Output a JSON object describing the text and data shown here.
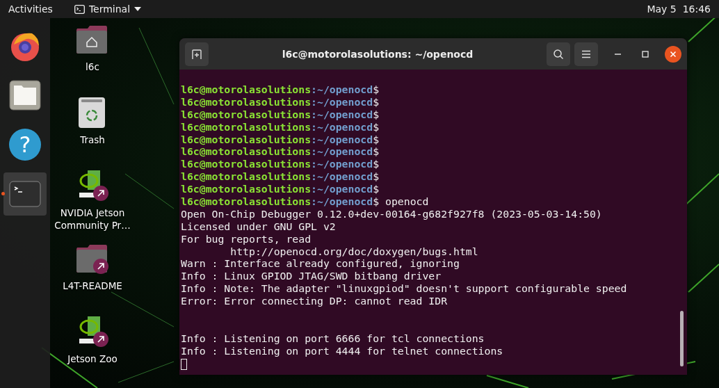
{
  "top_bar": {
    "activities": "Activities",
    "app_menu": "Terminal",
    "clock": "May 5  16:46"
  },
  "dock": [
    {
      "kind": "browser",
      "running": false
    },
    {
      "kind": "files",
      "running": false
    },
    {
      "kind": "help",
      "running": false,
      "glyph": "?"
    },
    {
      "kind": "terminal",
      "running": true
    }
  ],
  "desktop_icons": [
    {
      "kind": "home",
      "label": "l6c",
      "link": false
    },
    {
      "kind": "trash",
      "label": "Trash",
      "link": false
    },
    {
      "kind": "nvidia",
      "label": "NVIDIA Jetson Community Pr…",
      "link": true
    },
    {
      "kind": "folder",
      "label": "L4T-README",
      "link": true
    },
    {
      "kind": "nvidia",
      "label": "Jetson Zoo",
      "link": true
    }
  ],
  "terminal": {
    "title": "l6c@motorolasolutions: ~/openocd",
    "lines": [
      {
        "kind": "prompt",
        "user": "l6c@motorolasolutions",
        "path": ":~/openocd",
        "sign": "$"
      },
      {
        "kind": "prompt",
        "user": "l6c@motorolasolutions",
        "path": ":~/openocd",
        "sign": "$"
      },
      {
        "kind": "prompt",
        "user": "l6c@motorolasolutions",
        "path": ":~/openocd",
        "sign": "$"
      },
      {
        "kind": "prompt",
        "user": "l6c@motorolasolutions",
        "path": ":~/openocd",
        "sign": "$"
      },
      {
        "kind": "prompt",
        "user": "l6c@motorolasolutions",
        "path": ":~/openocd",
        "sign": "$"
      },
      {
        "kind": "prompt",
        "user": "l6c@motorolasolutions",
        "path": ":~/openocd",
        "sign": "$"
      },
      {
        "kind": "prompt",
        "user": "l6c@motorolasolutions",
        "path": ":~/openocd",
        "sign": "$"
      },
      {
        "kind": "prompt",
        "user": "l6c@motorolasolutions",
        "path": ":~/openocd",
        "sign": "$"
      },
      {
        "kind": "prompt",
        "user": "l6c@motorolasolutions",
        "path": ":~/openocd",
        "sign": "$"
      },
      {
        "kind": "prompt",
        "user": "l6c@motorolasolutions",
        "path": ":~/openocd",
        "sign": "$",
        "command": "openocd"
      },
      {
        "kind": "output",
        "text": "Open On-Chip Debugger 0.12.0+dev-00164-g682f927f8 (2023-05-03-14:50)"
      },
      {
        "kind": "output",
        "text": "Licensed under GNU GPL v2"
      },
      {
        "kind": "output",
        "text": "For bug reports, read"
      },
      {
        "kind": "output",
        "text": "        http://openocd.org/doc/doxygen/bugs.html"
      },
      {
        "kind": "output",
        "text": "Warn : Interface already configured, ignoring"
      },
      {
        "kind": "output",
        "text": "Info : Linux GPIOD JTAG/SWD bitbang driver"
      },
      {
        "kind": "output",
        "text": "Info : Note: The adapter \"linuxgpiod\" doesn't support configurable speed"
      },
      {
        "kind": "output",
        "text": "Error: Error connecting DP: cannot read IDR"
      },
      {
        "kind": "blank"
      },
      {
        "kind": "blank"
      },
      {
        "kind": "output",
        "text": "Info : Listening on port 6666 for tcl connections"
      },
      {
        "kind": "output",
        "text": "Info : Listening on port 4444 for telnet connections"
      },
      {
        "kind": "cursor"
      }
    ]
  }
}
